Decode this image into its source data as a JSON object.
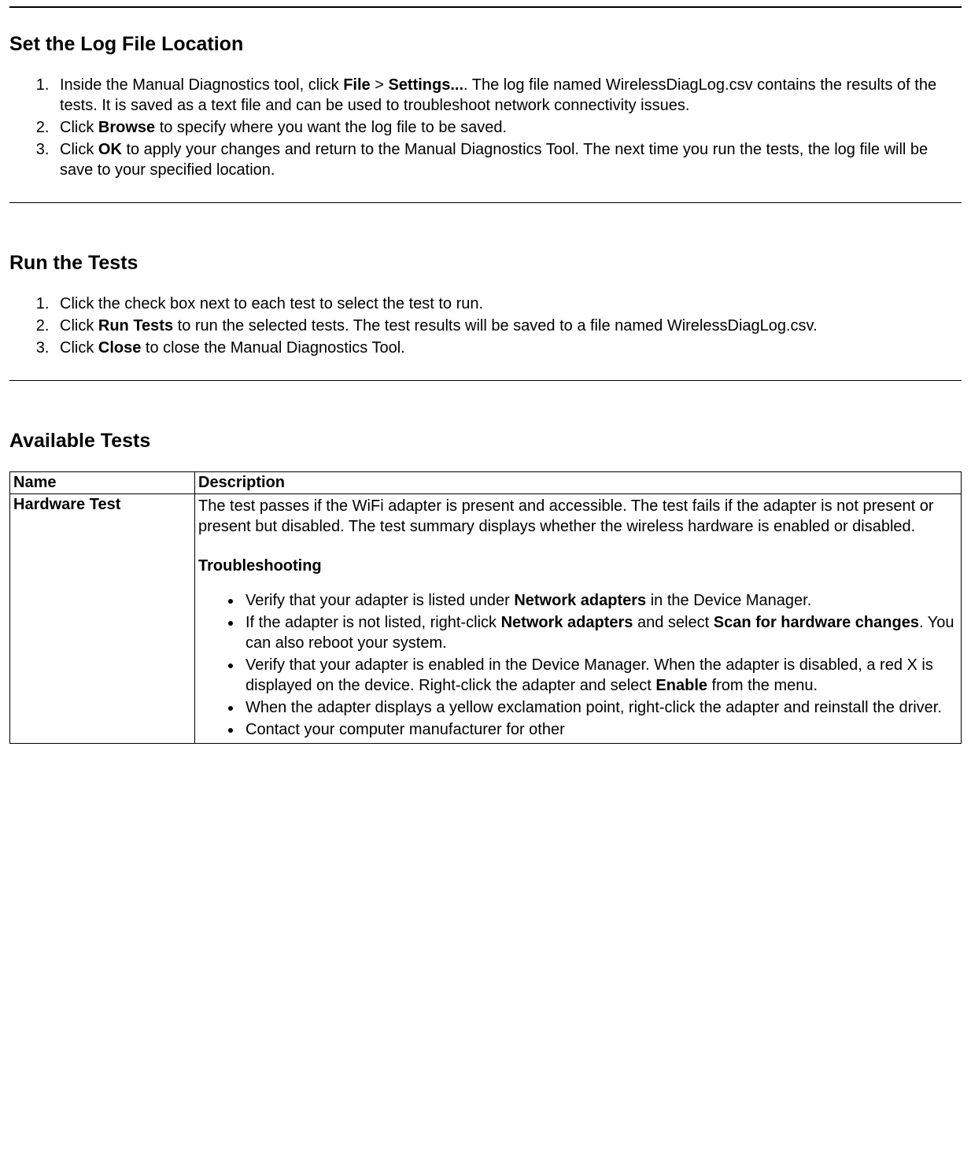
{
  "section1": {
    "heading": "Set the Log File Location",
    "items": [
      {
        "pre1": "Inside the Manual Diagnostics tool, click ",
        "bold1": "File",
        "mid1": " > ",
        "bold2": "Settings...",
        "post1": ". The log file named WirelessDiagLog.csv contains the results of the tests. It is saved as a text file and can be used to troubleshoot network connectivity issues."
      },
      {
        "pre1": "Click ",
        "bold1": "Browse",
        "post1": " to specify where you want the log file to be saved."
      },
      {
        "pre1": "Click ",
        "bold1": "OK",
        "post1": " to apply your changes and return to the Manual Diagnostics Tool. The next time you run the tests, the log file will be save to your specified location."
      }
    ]
  },
  "section2": {
    "heading": "Run the Tests",
    "items": [
      {
        "pre1": "Click the check box next to each test to select the test to run."
      },
      {
        "pre1": "Click ",
        "bold1": "Run Tests",
        "post1": " to run the selected tests. The test results will be saved to a file named WirelessDiagLog.csv."
      },
      {
        "pre1": "Click ",
        "bold1": "Close",
        "post1": " to close the Manual Diagnostics Tool."
      }
    ]
  },
  "section3": {
    "heading": "Available Tests",
    "table": {
      "headers": {
        "name": "Name",
        "desc": "Description"
      },
      "row1": {
        "name": "Hardware Test",
        "summary": "The test passes if the WiFi adapter is present and accessible. The test fails if the adapter is not present or present but disabled. The test summary displays whether the wireless hardware is enabled or disabled.",
        "subheading": "Troubleshooting",
        "bullets": [
          {
            "pre1": "Verify that your adapter is listed under ",
            "bold1": "Network adapters",
            "post1": " in the Device Manager."
          },
          {
            "pre1": "If the adapter is not listed, right-click ",
            "bold1": "Network adapters",
            "mid1": " and select ",
            "bold2": "Scan for hardware changes",
            "post1": ". You can also reboot your system."
          },
          {
            "pre1": "Verify that your adapter is enabled in the Device Manager. When the adapter is disabled, a red X is displayed on the device. Right-click the adapter and select ",
            "bold1": "Enable",
            "post1": " from the menu."
          },
          {
            "pre1": "When the adapter displays a yellow exclamation point, right-click the adapter and reinstall the driver."
          },
          {
            "pre1": "Contact your computer manufacturer for other"
          }
        ]
      }
    }
  }
}
